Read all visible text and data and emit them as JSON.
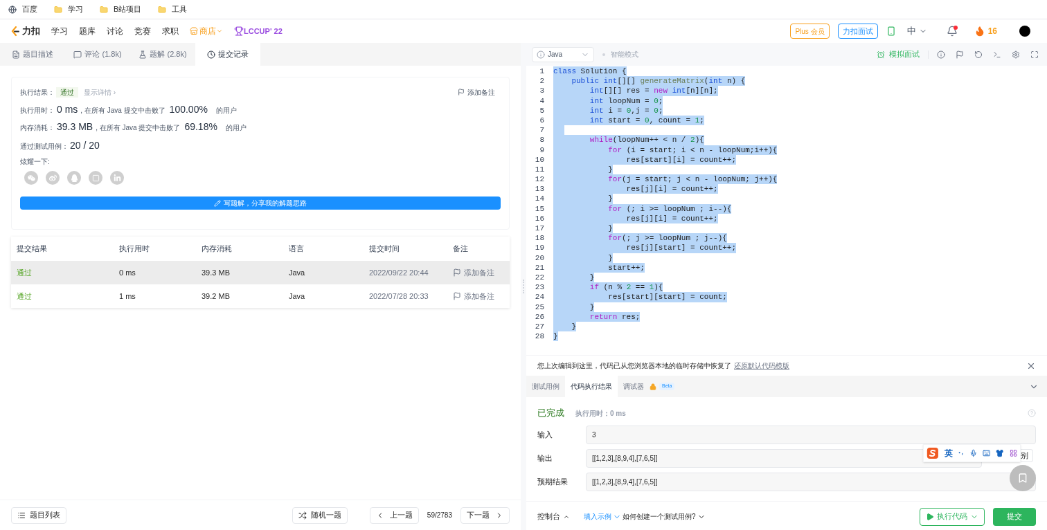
{
  "bookmarks": [
    {
      "kind": "site",
      "label": "百度"
    },
    {
      "kind": "folder",
      "label": "学习"
    },
    {
      "kind": "folder",
      "label": "B站项目"
    },
    {
      "kind": "folder",
      "label": "工具"
    }
  ],
  "nav": {
    "brand": "力扣",
    "links": [
      "学习",
      "题库",
      "讨论",
      "竞赛",
      "求职"
    ],
    "store": "商店",
    "contest": "LCCUP' 22",
    "plus": "Plus 会员",
    "interview": "力扣面试",
    "language": "中",
    "notification_unread": true,
    "streak": "16"
  },
  "left_tabs": [
    {
      "kind": "description",
      "label": "题目描述",
      "selected": false
    },
    {
      "kind": "comments",
      "label": "评论 (1.8k)",
      "selected": false
    },
    {
      "kind": "solutions",
      "label": "题解 (2.8k)",
      "selected": false
    },
    {
      "kind": "submissions",
      "label": "提交记录",
      "selected": true
    }
  ],
  "result": {
    "status_label": "执行结果：",
    "status": "通过",
    "details_link": "显示详情 ›",
    "add_note": "添加备注",
    "stats": [
      {
        "label": "执行用时：",
        "value": "0 ms",
        "text": ", 在所有 Java 提交中击败了",
        "percent": "100.00%",
        "suffix": "的用户"
      },
      {
        "label": "内存消耗：",
        "value": "39.3 MB",
        "text": ", 在所有 Java 提交中击败了",
        "percent": "69.18%",
        "suffix": "的用户"
      }
    ],
    "tests_label": "通过测试用例：",
    "tests": "20 / 20",
    "share_label": "炫耀一下:",
    "write_button": "写题解，分享我的解题思路"
  },
  "history": {
    "columns": [
      "提交结果",
      "执行用时",
      "内存消耗",
      "语言",
      "提交时间",
      "备注"
    ],
    "rows": [
      {
        "status": "通过",
        "runtime": "0 ms",
        "memory": "39.3 MB",
        "language": "Java",
        "time": "2022/09/22 20:44",
        "note": "添加备注",
        "hovered": true
      },
      {
        "status": "通过",
        "runtime": "1 ms",
        "memory": "39.2 MB",
        "language": "Java",
        "time": "2022/07/28 20:33",
        "note": "添加备注",
        "hovered": false
      }
    ]
  },
  "editor": {
    "language": "Java",
    "smart_mode": "智能模式",
    "mock_interview": "模拟面试",
    "selection": true,
    "lines": [
      {
        "number": "1",
        "tokens": [
          {
            "kind": "kw",
            "text": "class"
          },
          {
            "kind": "plain",
            "text": " Solution {"
          }
        ]
      },
      {
        "number": "2",
        "tokens": [
          {
            "kind": "kw",
            "text": "    public"
          },
          {
            "kind": "kw",
            "text": " int"
          },
          {
            "kind": "plain",
            "text": "[][] "
          },
          {
            "kind": "fn",
            "text": "generateMatrix"
          },
          {
            "kind": "plain",
            "text": "("
          },
          {
            "kind": "kw",
            "text": "int"
          },
          {
            "kind": "plain",
            "text": " n) {"
          }
        ]
      },
      {
        "number": "3",
        "tokens": [
          {
            "kind": "kw",
            "text": "        int"
          },
          {
            "kind": "plain",
            "text": "[][] res = "
          },
          {
            "kind": "ctrl",
            "text": "new"
          },
          {
            "kind": "kw",
            "text": " int"
          },
          {
            "kind": "plain",
            "text": "[n][n];"
          }
        ]
      },
      {
        "number": "4",
        "tokens": [
          {
            "kind": "kw",
            "text": "        int"
          },
          {
            "kind": "plain",
            "text": " loopNum = "
          },
          {
            "kind": "num",
            "text": "0"
          },
          {
            "kind": "plain",
            "text": ";"
          }
        ]
      },
      {
        "number": "5",
        "tokens": [
          {
            "kind": "kw",
            "text": "        int"
          },
          {
            "kind": "plain",
            "text": " i = "
          },
          {
            "kind": "num",
            "text": "0"
          },
          {
            "kind": "plain",
            "text": ",j = "
          },
          {
            "kind": "num",
            "text": "0"
          },
          {
            "kind": "plain",
            "text": ";"
          }
        ]
      },
      {
        "number": "6",
        "tokens": [
          {
            "kind": "kw",
            "text": "        int"
          },
          {
            "kind": "plain",
            "text": " start = "
          },
          {
            "kind": "num",
            "text": "0"
          },
          {
            "kind": "plain",
            "text": ", count = "
          },
          {
            "kind": "num",
            "text": "1"
          },
          {
            "kind": "plain",
            "text": ";"
          }
        ]
      },
      {
        "number": "7"
      },
      {
        "number": "8",
        "tokens": [
          {
            "kind": "ctrl",
            "text": "        while"
          },
          {
            "kind": "plain",
            "text": "(loopNum++ < n / "
          },
          {
            "kind": "num",
            "text": "2"
          },
          {
            "kind": "plain",
            "text": "){"
          }
        ]
      },
      {
        "number": "9",
        "tokens": [
          {
            "kind": "ctrl",
            "text": "            for"
          },
          {
            "kind": "plain",
            "text": " (i = start; i < n - loopNum;i++){"
          }
        ]
      },
      {
        "number": "10",
        "tokens": [
          {
            "kind": "plain",
            "text": "                res[start][i] = count++;"
          }
        ]
      },
      {
        "number": "11",
        "tokens": [
          {
            "kind": "plain",
            "text": "            }"
          }
        ]
      },
      {
        "number": "12",
        "tokens": [
          {
            "kind": "ctrl",
            "text": "            for"
          },
          {
            "kind": "plain",
            "text": "(j = start; j < n - loopNum; j++){"
          }
        ]
      },
      {
        "number": "13",
        "tokens": [
          {
            "kind": "plain",
            "text": "                res[j][i] = count++;"
          }
        ]
      },
      {
        "number": "14",
        "tokens": [
          {
            "kind": "plain",
            "text": "            }"
          }
        ]
      },
      {
        "number": "15",
        "tokens": [
          {
            "kind": "ctrl",
            "text": "            for"
          },
          {
            "kind": "plain",
            "text": " (; i >= loopNum ; i--){"
          }
        ]
      },
      {
        "number": "16",
        "tokens": [
          {
            "kind": "plain",
            "text": "                res[j][i] = count++;"
          }
        ]
      },
      {
        "number": "17",
        "tokens": [
          {
            "kind": "plain",
            "text": "            }"
          }
        ]
      },
      {
        "number": "18",
        "tokens": [
          {
            "kind": "ctrl",
            "text": "            for"
          },
          {
            "kind": "plain",
            "text": "(; j >= loopNum ; j--){"
          }
        ]
      },
      {
        "number": "19",
        "tokens": [
          {
            "kind": "plain",
            "text": "                res[j][start] = count++;"
          }
        ]
      },
      {
        "number": "20",
        "tokens": [
          {
            "kind": "plain",
            "text": "            }"
          }
        ]
      },
      {
        "number": "21",
        "tokens": [
          {
            "kind": "plain",
            "text": "            start++;"
          }
        ]
      },
      {
        "number": "22",
        "tokens": [
          {
            "kind": "plain",
            "text": "        }"
          }
        ]
      },
      {
        "number": "23",
        "tokens": [
          {
            "kind": "ctrl",
            "text": "        if"
          },
          {
            "kind": "plain",
            "text": " (n % "
          },
          {
            "kind": "num",
            "text": "2"
          },
          {
            "kind": "plain",
            "text": " == "
          },
          {
            "kind": "num",
            "text": "1"
          },
          {
            "kind": "plain",
            "text": "){"
          }
        ]
      },
      {
        "number": "24",
        "tokens": [
          {
            "kind": "plain",
            "text": "            res[start][start] = count;"
          }
        ]
      },
      {
        "number": "25",
        "tokens": [
          {
            "kind": "plain",
            "text": "        }"
          }
        ]
      },
      {
        "number": "26",
        "tokens": [
          {
            "kind": "ctrl",
            "text": "        return"
          },
          {
            "kind": "plain",
            "text": " res;"
          }
        ]
      },
      {
        "number": "27",
        "tokens": [
          {
            "kind": "plain",
            "text": "    }"
          }
        ]
      },
      {
        "number": "28",
        "tokens": [
          {
            "kind": "plain",
            "text": "}"
          }
        ]
      }
    ]
  },
  "restore_notice": {
    "text": "您上次编辑到这里，代码已从您浏览器本地的临时存储中恢复了",
    "link": "还原默认代码模版"
  },
  "console_tabs": [
    {
      "label": "测试用例",
      "selected": false,
      "locked": false
    },
    {
      "label": "代码执行结果",
      "selected": true,
      "locked": false
    },
    {
      "label": "调试器",
      "selected": false,
      "locked": true,
      "badge": "Beta"
    }
  ],
  "run_result": {
    "status": "已完成",
    "runtime": "执行用时：0 ms",
    "fields": [
      {
        "label": "输入",
        "value": "3",
        "has_diff": false
      },
      {
        "label": "输出",
        "value": "[[1,2,3],[8,9,4],[7,6,5]]",
        "has_diff": true
      },
      {
        "label": "预期结果",
        "value": "[[1,2,3],[8,9,4],[7,6,5]]",
        "has_diff": false
      }
    ],
    "diff_button": "别"
  },
  "ime_toolbar": {
    "mode": "英"
  },
  "bottom_left": {
    "problem_list": "题目列表",
    "random": "随机一题",
    "prev": "上一题",
    "counter": "59/2783",
    "next": "下一题"
  },
  "bottom_right": {
    "console": "控制台",
    "fill_example": "填入示例",
    "how_to": "如何创建一个测试用例?",
    "run": "执行代码",
    "submit": "提交"
  }
}
